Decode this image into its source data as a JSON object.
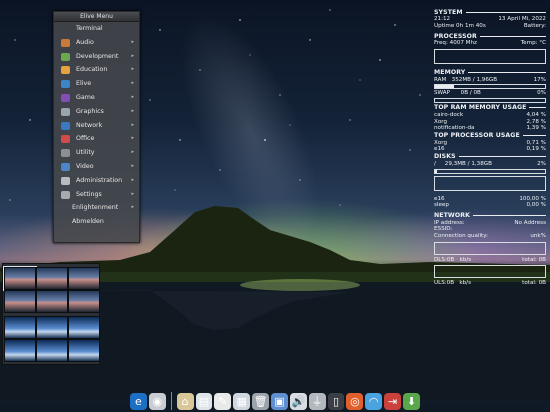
{
  "menu": {
    "title": "Elive Menu",
    "items": [
      {
        "label": "Terminal",
        "icon": "terminal-icon",
        "color": "",
        "submenu": false
      },
      {
        "label": "Audio",
        "icon": "audio-icon",
        "color": "#c97a3a",
        "submenu": true
      },
      {
        "label": "Development",
        "icon": "development-icon",
        "color": "#6aa84f",
        "submenu": true
      },
      {
        "label": "Education",
        "icon": "education-icon",
        "color": "#e6a23c",
        "submenu": true
      },
      {
        "label": "Elive",
        "icon": "elive-icon",
        "color": "#3d85c6",
        "submenu": true
      },
      {
        "label": "Game",
        "icon": "game-icon",
        "color": "#7f4fb3",
        "submenu": true
      },
      {
        "label": "Graphics",
        "icon": "graphics-icon",
        "color": "#9aa4ad",
        "submenu": true
      },
      {
        "label": "Network",
        "icon": "network-icon",
        "color": "#3a78c2",
        "submenu": true
      },
      {
        "label": "Office",
        "icon": "office-icon",
        "color": "#d24b4b",
        "submenu": true
      },
      {
        "label": "Utility",
        "icon": "utility-icon",
        "color": "#8d8f93",
        "submenu": true
      },
      {
        "label": "Video",
        "icon": "video-icon",
        "color": "#4a86c8",
        "submenu": true
      },
      {
        "label": "Administration",
        "icon": "administration-icon",
        "color": "#b8bcc2",
        "submenu": true
      },
      {
        "label": "Settings",
        "icon": "settings-icon",
        "color": "#a7abb0",
        "submenu": true
      },
      {
        "label": "Enlightenment",
        "icon": "",
        "color": "",
        "submenu": true
      },
      {
        "label": "Abmelden",
        "icon": "",
        "color": "",
        "submenu": false
      }
    ]
  },
  "conky": {
    "system": {
      "header": "SYSTEM",
      "time": "21:12",
      "date": "13 April Mi, 2022",
      "uptime": "Uptime 0h 1m 40s",
      "battery": "Battery:"
    },
    "processor": {
      "header": "PROCESSOR",
      "freq": "Freq: 4007 Mhz",
      "temp": "Temp: °C"
    },
    "memory": {
      "header": "MEMORY",
      "ram_label": "RAM",
      "ram_value": "352MB / 1,96GB",
      "ram_pct": "17%",
      "ram_fill": 0.17,
      "swap_label": "SWAP",
      "swap_value": "0B  / 0B",
      "swap_pct": "0%"
    },
    "top_ram": {
      "header": "TOP RAM MEMORY USAGE",
      "rows": [
        {
          "name": "cairo-dock",
          "value": "4,04 %"
        },
        {
          "name": "Xorg",
          "value": "2,78 %"
        },
        {
          "name": "notification-da",
          "value": "1,39 %"
        }
      ]
    },
    "top_cpu": {
      "header": "TOP PROCESSOR USAGE",
      "rows": [
        {
          "name": "Xorg",
          "value": "0,71 %"
        },
        {
          "name": "e16",
          "value": "0,19 %"
        }
      ]
    },
    "disks": {
      "header": "DISKS",
      "root_label": "/",
      "root_value": "29,3MB / 1,38GB",
      "root_pct": "2%",
      "root_fill": 0.02,
      "e16_label": "e16",
      "e16_value": "100,00 %",
      "sleep_label": "sleep",
      "sleep_value": "0,00 %"
    },
    "network": {
      "header": "NETWORK",
      "ip_label": "IP address:",
      "ip_value": "No Address",
      "essid_label": "ESSID:",
      "quality_label": "Connection quality:",
      "quality_value": "unk%",
      "dl_label": "DLS:0B",
      "dl_unit": "kb/s",
      "dl_total": "total: 0B",
      "ul_label": "ULS:0B",
      "ul_unit": "kb/s",
      "ul_total": "total: 0B"
    }
  },
  "dock": {
    "items": [
      {
        "name": "elive-icon",
        "glyph": "e",
        "color": "#1d6fc4"
      },
      {
        "name": "cd-icon",
        "glyph": "◉",
        "color": "#c9ccd2"
      },
      {
        "name": "home-icon",
        "glyph": "⌂",
        "color": "#d9c79a"
      },
      {
        "name": "document-icon",
        "glyph": "▤",
        "color": "#dfe4ea"
      },
      {
        "name": "text-editor-icon",
        "glyph": "✎",
        "color": "#e9e9e9"
      },
      {
        "name": "calendar-icon",
        "glyph": "▦",
        "color": "#cfd6de"
      },
      {
        "name": "trash-icon",
        "glyph": "🗑",
        "color": "#9da3aa"
      },
      {
        "name": "file-manager-icon",
        "glyph": "▣",
        "color": "#5f8fd0"
      },
      {
        "name": "volume-icon",
        "glyph": "🔊",
        "color": "#d9dde2"
      },
      {
        "name": "usb-icon",
        "glyph": "⏚",
        "color": "#b3b8be"
      },
      {
        "name": "terminal-icon",
        "glyph": "▯",
        "color": "#3b3f45"
      },
      {
        "name": "help-icon",
        "glyph": "◎",
        "color": "#e0602c"
      },
      {
        "name": "wifi-icon",
        "glyph": "◠",
        "color": "#4aa3df"
      },
      {
        "name": "logout-icon",
        "glyph": "⇥",
        "color": "#c9413a"
      },
      {
        "name": "download-icon",
        "glyph": "⬇",
        "color": "#5aa64a"
      }
    ]
  }
}
